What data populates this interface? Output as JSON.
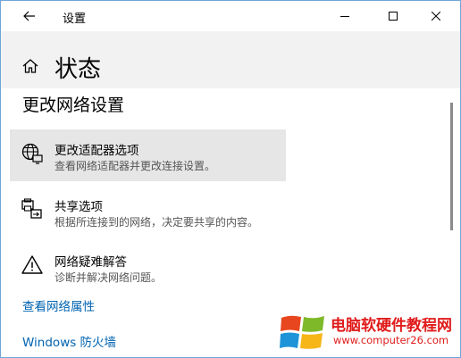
{
  "window": {
    "title": "设置",
    "controls": {
      "minimize": "minimize-icon",
      "maximize": "maximize-icon",
      "close": "close-icon"
    }
  },
  "header": {
    "page_title": "状态",
    "home_icon": "home-icon",
    "back_icon": "arrow-left-icon"
  },
  "section": {
    "title": "更改网络设置"
  },
  "items": [
    {
      "icon": "globe-monitor-icon",
      "title": "更改适配器选项",
      "description": "查看网络适配器并更改连接设置。"
    },
    {
      "icon": "printer-share-icon",
      "title": "共享选项",
      "description": "根据所连接到的网络，决定要共享的内容。"
    },
    {
      "icon": "warning-icon",
      "title": "网络疑难解答",
      "description": "诊断并解决网络问题。"
    }
  ],
  "links": {
    "view_properties": "查看网络属性",
    "firewall": "Windows 防火墙"
  },
  "watermark": {
    "title": "电脑软硬件教程网",
    "url": "www.computer26.com"
  },
  "colors": {
    "accent": "#0063b1",
    "header_bg": "#f2f2f2",
    "hover_bg": "#e6e6e6",
    "watermark": "#e11b1b"
  }
}
